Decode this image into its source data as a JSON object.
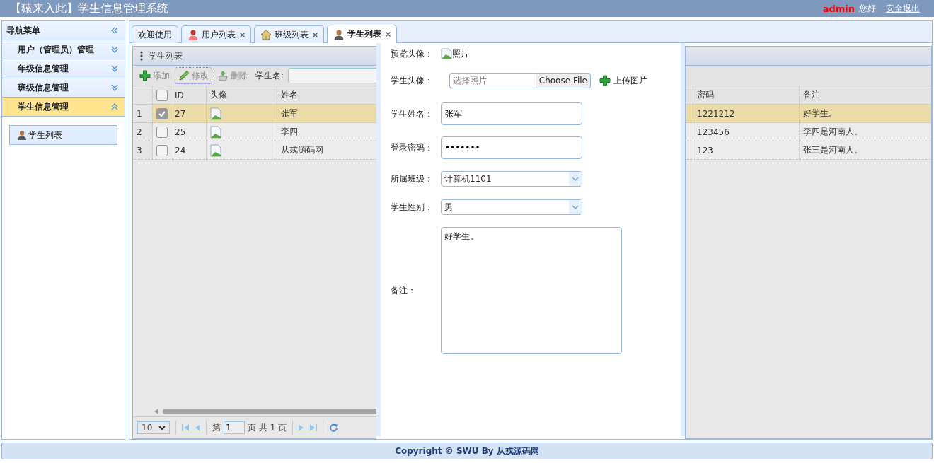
{
  "header": {
    "title": "【猿来入此】学生信息管理系统",
    "user": "admin",
    "greeting": "您好",
    "logout": "安全退出"
  },
  "sidebar": {
    "title": "导航菜单",
    "groups": [
      {
        "label": "用户（管理员）管理",
        "expanded": false
      },
      {
        "label": "年级信息管理",
        "expanded": false
      },
      {
        "label": "班级信息管理",
        "expanded": false
      },
      {
        "label": "学生信息管理",
        "expanded": true,
        "children": [
          {
            "label": "学生列表"
          }
        ]
      }
    ]
  },
  "tabs": [
    {
      "label": "欢迎使用",
      "closable": false,
      "selected": false
    },
    {
      "label": "用户列表",
      "closable": true,
      "selected": false
    },
    {
      "label": "班级列表",
      "closable": true,
      "selected": false
    },
    {
      "label": "学生列表",
      "closable": true,
      "selected": true
    }
  ],
  "grid": {
    "title": "学生列表",
    "toolbar": [
      {
        "label": "添加",
        "focused": false
      },
      {
        "label": "修改",
        "focused": true
      },
      {
        "label": "删除",
        "focused": false
      }
    ],
    "search_label": "学生名:",
    "select_all": false,
    "left_columns": [
      "ID",
      "头像",
      "姓名"
    ],
    "right_columns": [
      "密码",
      "备注"
    ],
    "rows": [
      {
        "number": "1",
        "checked": true,
        "selected": true,
        "id": "27",
        "name": "张军",
        "password": "1221212",
        "note": "好学生。"
      },
      {
        "number": "2",
        "checked": false,
        "selected": false,
        "id": "25",
        "name": "李四",
        "password": "123456",
        "note": "李四是河南人。"
      },
      {
        "number": "3",
        "checked": false,
        "selected": false,
        "id": "24",
        "name": "从戎源码网",
        "password": "123",
        "note": "张三是河南人。"
      }
    ],
    "pager": {
      "page_size": "10",
      "page_prefix": "第",
      "page": "1",
      "page_suffix": "页 共 1 页"
    }
  },
  "form": {
    "fields": [
      {
        "kind": "preview",
        "label": "预览头像：",
        "alt": "照片"
      },
      {
        "kind": "file",
        "label": "学生头像：",
        "placeholder": "选择照片",
        "button": "Choose File",
        "upload": "上传图片"
      },
      {
        "kind": "text",
        "label": "学生姓名：",
        "value": "张军"
      },
      {
        "kind": "password",
        "label": "登录密码：",
        "value": "•••••••"
      },
      {
        "kind": "select",
        "label": "所属班级：",
        "value": "计算机1101"
      },
      {
        "kind": "select",
        "label": "学生性别：",
        "value": "男"
      },
      {
        "kind": "textarea",
        "label": "备注：",
        "value": "好学生。"
      }
    ]
  },
  "footer": "Copyright © SWU By 从戎源码网"
}
